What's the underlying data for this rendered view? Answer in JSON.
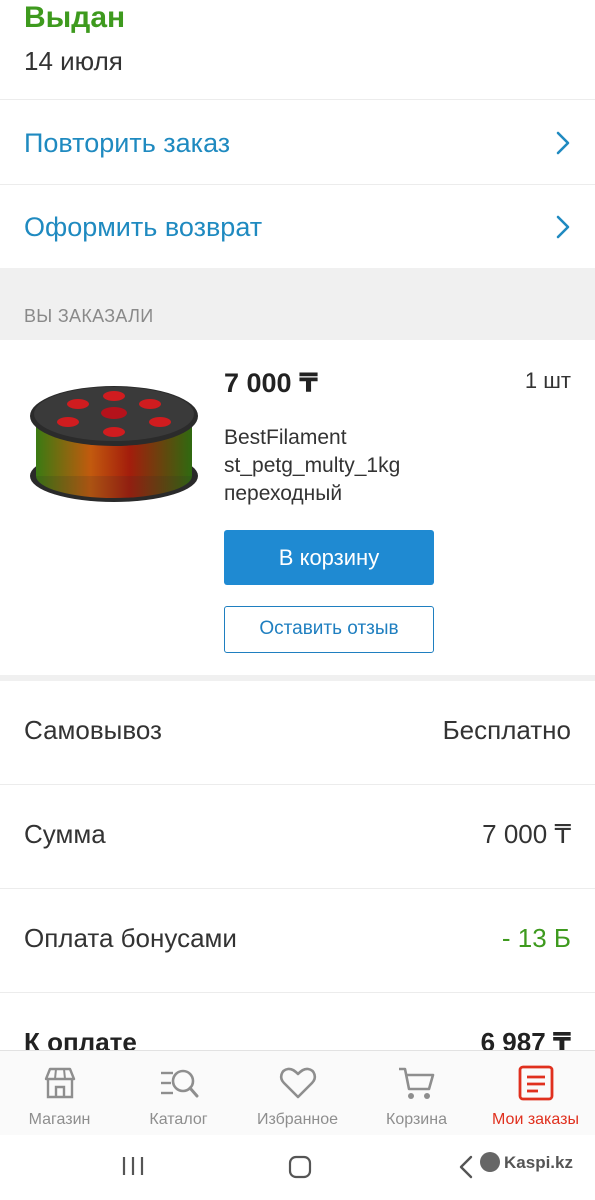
{
  "status": {
    "title": "Выдан",
    "date": "14 июля"
  },
  "actions": [
    {
      "label": "Повторить заказ"
    },
    {
      "label": "Оформить возврат"
    }
  ],
  "section": {
    "title": "ВЫ ЗАКАЗАЛИ"
  },
  "product": {
    "price": "7 000 ₸",
    "quantity": "1 шт",
    "name_lines": [
      "BestFilament",
      "st_petg_multy_1kg",
      "переходный"
    ],
    "cart_button": "В корзину",
    "review_button": "Оставить отзыв"
  },
  "summary": [
    {
      "key": "Самовывоз",
      "value": "Бесплатно"
    },
    {
      "key": "Сумма",
      "value": "7 000 ₸"
    },
    {
      "key": "Оплата бонусами",
      "value": "- 13 Б"
    },
    {
      "key": "К оплате",
      "value": "6 987 ₸"
    }
  ],
  "bottom_nav": [
    {
      "label": "Магазин",
      "icon": "shop-icon"
    },
    {
      "label": "Каталог",
      "icon": "catalog-search-icon"
    },
    {
      "label": "Избранное",
      "icon": "heart-icon"
    },
    {
      "label": "Корзина",
      "icon": "cart-icon"
    },
    {
      "label": "Мои заказы",
      "icon": "orders-icon",
      "active": true
    }
  ],
  "watermark": "Kaspi.kz",
  "colors": {
    "accent_blue": "#1f8ad2",
    "status_green": "#3e9a1e",
    "active_red": "#e0301e"
  }
}
